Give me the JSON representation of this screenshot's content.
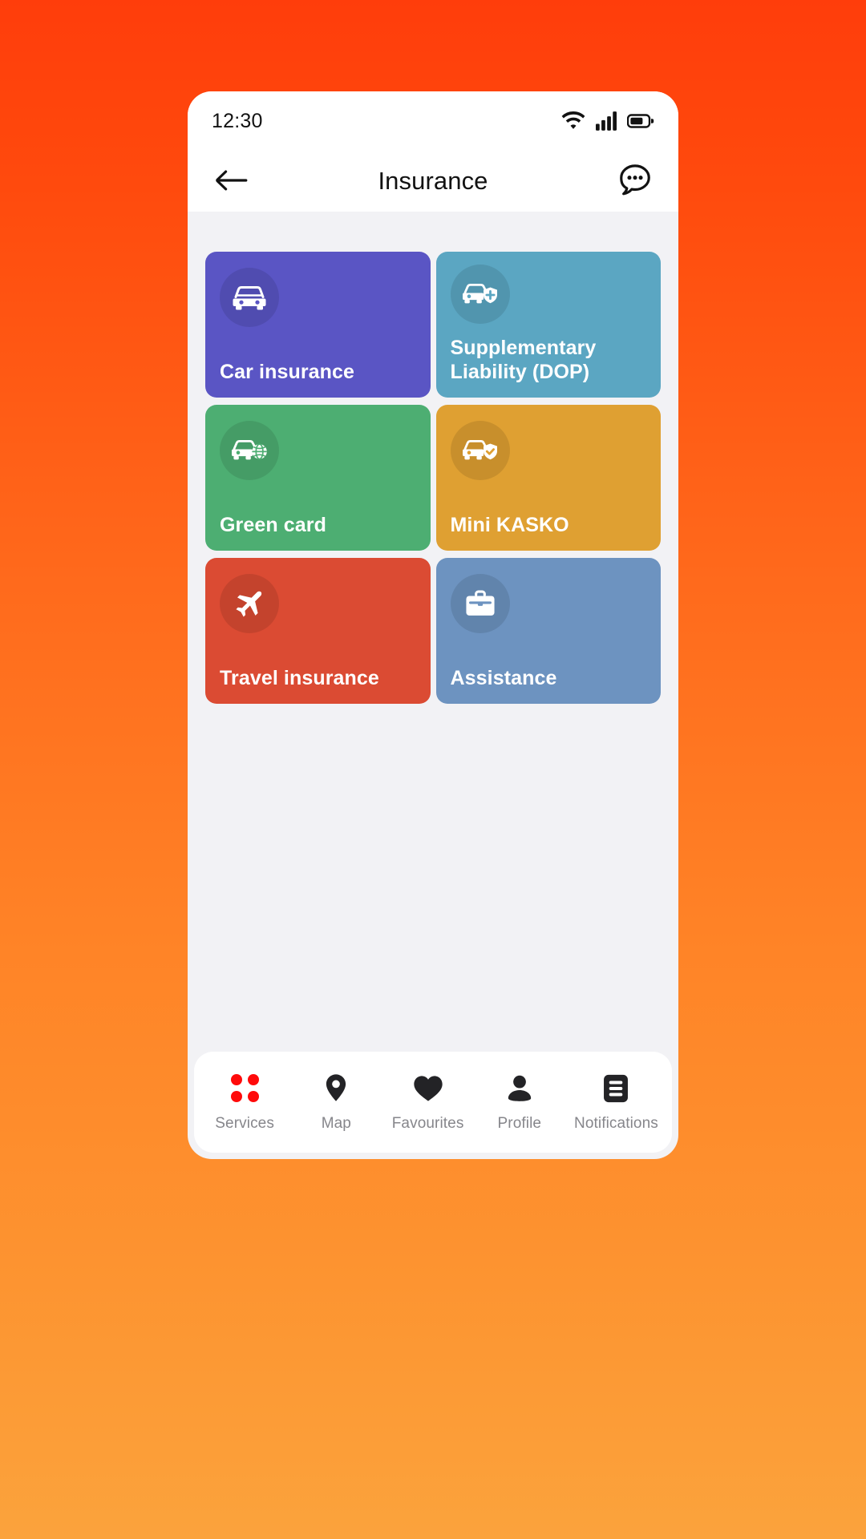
{
  "theme": {
    "bg_gradient_top": "#FF3D0B",
    "bg_gradient_bottom": "#FBA33C",
    "screen_bg": "#F2F2F5",
    "surface": "#FFFFFF",
    "text_primary": "#121212",
    "nav_label": "#86868B",
    "nav_active_accent": "#FF0A0A"
  },
  "status_bar": {
    "time": "12:30",
    "icons": [
      "wifi-icon",
      "cellular-signal-icon",
      "battery-icon"
    ]
  },
  "app_bar": {
    "back_icon": "back-arrow-icon",
    "title": "Insurance",
    "chat_icon": "chat-bubble-icon"
  },
  "services": {
    "items": [
      {
        "label": "Car insurance",
        "icon": "car-icon",
        "color": "#5A55C4"
      },
      {
        "label": "Supplementary Liability (DOP)",
        "icon": "car-shield-plus-icon",
        "color": "#5BA6C2"
      },
      {
        "label": "Green card",
        "icon": "car-globe-icon",
        "color": "#4DAE72"
      },
      {
        "label": "Mini KASKO",
        "icon": "car-shield-check-icon",
        "color": "#DFA032"
      },
      {
        "label": "Travel insurance",
        "icon": "airplane-icon",
        "color": "#DB4B33"
      },
      {
        "label": "Assistance",
        "icon": "briefcase-icon",
        "color": "#6D93C0"
      }
    ]
  },
  "bottom_nav": {
    "items": [
      {
        "label": "Services",
        "icon": "grid-dots-icon",
        "active": true
      },
      {
        "label": "Map",
        "icon": "map-pin-icon",
        "active": false
      },
      {
        "label": "Favourites",
        "icon": "heart-icon",
        "active": false
      },
      {
        "label": "Profile",
        "icon": "person-icon",
        "active": false
      },
      {
        "label": "Notifications",
        "icon": "list-square-icon",
        "active": false
      }
    ]
  }
}
